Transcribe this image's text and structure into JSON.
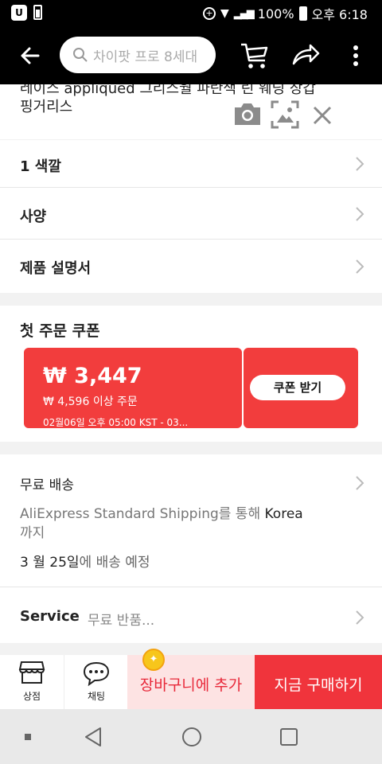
{
  "status_bar": {
    "battery": "100%",
    "time": "오후 6:18"
  },
  "header": {
    "search_placeholder": "차이팟 프로 8세대"
  },
  "product": {
    "title_line1": "레이스 appliqued 그리스월 파란색 린 웨딩 장갑",
    "title_line2": "핑거리스"
  },
  "options": [
    {
      "label": "1 색깔"
    },
    {
      "label": "사양"
    },
    {
      "label": "제품 설명서"
    }
  ],
  "coupon": {
    "heading": "첫 주문 쿠폰",
    "amount": "₩ 3,447",
    "condition": "₩ 4,596 이상 주문",
    "validity": "02월06일 오후 05:00 KST - 03...",
    "button": "쿠폰 받기"
  },
  "shipping": {
    "label": "무료 배송",
    "line1_pre": "AliExpress Standard Shipping를 통해 ",
    "line1_dest": "Korea",
    "line2": "까지",
    "date": "3 월 25일",
    "date_suffix": "에 배송 예정"
  },
  "service": {
    "label": "Service",
    "value": "무료 반품..."
  },
  "actions": {
    "store": "상점",
    "chat": "채팅",
    "add_cart": "장바구니에 추가",
    "buy_now": "지금 구매하기"
  },
  "colors": {
    "accent_red": "#f23d3d",
    "buy_red": "#f0343c",
    "cart_pink": "#fde3e3",
    "coin_gold": "#f7c61b"
  }
}
